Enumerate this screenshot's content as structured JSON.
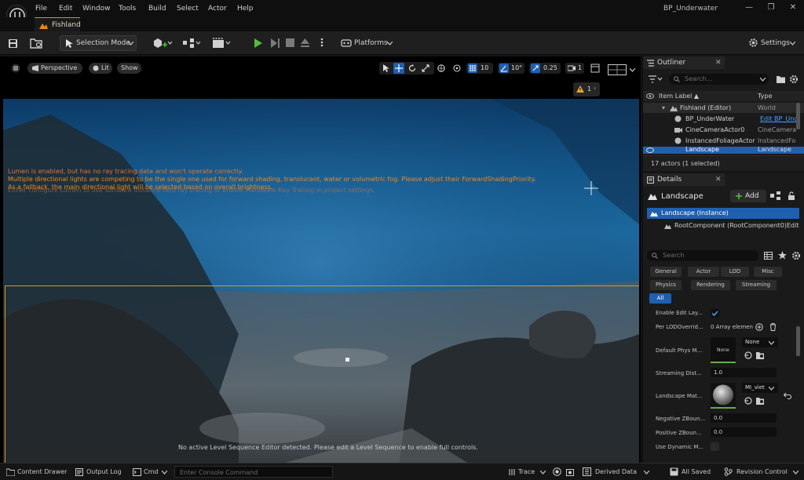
{
  "window": {
    "title": "BP_Underwater",
    "menu": [
      "File",
      "Edit",
      "Window",
      "Tools",
      "Build",
      "Select",
      "Actor",
      "Help"
    ],
    "document_tab": "Fishland"
  },
  "toolbar": {
    "selection_mode": "Selection Mode",
    "platforms": "Platforms",
    "settings": "Settings"
  },
  "viewport": {
    "perspective": "Perspective",
    "lit": "Lit",
    "show": "Show",
    "grid_snap": "10",
    "rotation_snap": "10°",
    "scale_snap": "0.25",
    "camera_speed": "1",
    "warning_count": "1",
    "warnings": [
      "Lumen is enabled, but has no ray tracing data and won't operate correctly.",
      "Multiple directional lights are competing to be the single one used for forward shading, translucent, water or volumetric fog. Please adjust their ForwardShadingPriority.",
      "As a fallback, the main directional light will be selected based on overall brightness.",
      "Either configure Lumen to use software distance field ray tracing or enable Hardware Ray Tracing in project settings."
    ],
    "sequencer_message": "No active Level Sequence Editor detected. Please edit a Level Sequence to enable full controls."
  },
  "outliner": {
    "tab": "Outliner",
    "search_placeholder": "Search...",
    "col_label": "Item Label ▲",
    "col_type": "Type",
    "rows": [
      {
        "label": "Fishland (Editor)",
        "type": "World"
      },
      {
        "label": "BP_UnderWater",
        "type": "Edit BP_Und"
      },
      {
        "label": "CineCameraActor0",
        "type": "CineCamera"
      },
      {
        "label": "InstancedFoliageActor",
        "type": "InstancedFo"
      },
      {
        "label": "Landscape",
        "type": "Landscape"
      }
    ],
    "count": "17 actors (1 selected)"
  },
  "details": {
    "tab": "Details",
    "actor_name": "Landscape",
    "add_label": "Add",
    "instance": "Landscape (Instance)",
    "root_component": "RootComponent (RootComponent0)",
    "root_edit": "Edit",
    "search_placeholder": "Search",
    "filters_row1": [
      "General",
      "Actor",
      "LOD",
      "Misc"
    ],
    "filters_row2": [
      "Physics",
      "Rendering",
      "Streaming"
    ],
    "filter_all": "All",
    "props": {
      "enable_edit_layers": "Enable Edit Lay...",
      "per_lod_override": "Per LODOverrid...",
      "per_lod_value": "0 Array elemen",
      "default_phys": "Default Phys M...",
      "none_thumb": "None",
      "none_select": "None",
      "streaming_dist": "Streaming Dist...",
      "streaming_value": "1.0",
      "landscape_mat": "Landscape Mat...",
      "material_value": "MI_viet",
      "neg_z": "Negative ZBoun...",
      "neg_z_value": "0.0",
      "pos_z": "Positive ZBoun...",
      "pos_z_value": "0.0",
      "use_dynamic": "Use Dynamic M..."
    }
  },
  "statusbar": {
    "content_drawer": "Content Drawer",
    "output_log": "Output Log",
    "cmd": "Cmd",
    "console_placeholder": "Enter Console Command",
    "trace": "Trace",
    "derived_data": "Derived Data",
    "all_saved": "All Saved",
    "revision_control": "Revision Control"
  },
  "colors": {
    "accent_orange": "#e58b0e",
    "selection_blue": "#1f5fb0",
    "play_green": "#4fbf3a",
    "warning_orange": "#d9822b"
  }
}
